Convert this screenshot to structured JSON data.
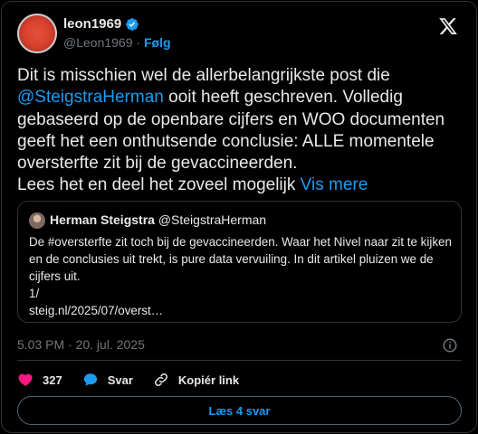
{
  "author": {
    "name": "leon1969",
    "handle": "@Leon1969",
    "separator": "·",
    "follow_label": "Følg"
  },
  "tweet": {
    "line1_text": "Dit is misschien wel de allerbelangrijkste post die ",
    "mention": "@SteigstraHerman",
    "line2_text": " ooit heeft geschreven. Volledig gebaseerd op de openbare cijfers en WOO documenten geeft het een onthutsende conclusie: ALLE momentele oversterfte zit bij de gevaccineerden.",
    "line3_text": "Lees het en deel het zoveel mogelijk ",
    "more_label": "Vis mere"
  },
  "quote": {
    "name": "Herman Steigstra",
    "handle": "@SteigstraHerman",
    "body_line1": "De #oversterfte zit toch bij de gevaccineerden. Waar het Nivel naar zit te kijken en de conclusies uit trekt, is pure data vervuiling. In dit artikel pluizen we de cijfers uit.",
    "body_line2": "1/",
    "body_line3": "steig.nl/2025/07/overst…"
  },
  "meta": {
    "timestamp": "5.03 PM · 20. jul. 2025"
  },
  "actions": {
    "like_count": "327",
    "reply_label": "Svar",
    "copy_label": "Kopiér link"
  },
  "replies_button": {
    "label": "Læs 4 svar"
  },
  "colors": {
    "accent": "#1d9bf0",
    "like": "#f91880",
    "text": "#e7e9ea",
    "muted": "#71767b",
    "border": "#2f3336"
  }
}
